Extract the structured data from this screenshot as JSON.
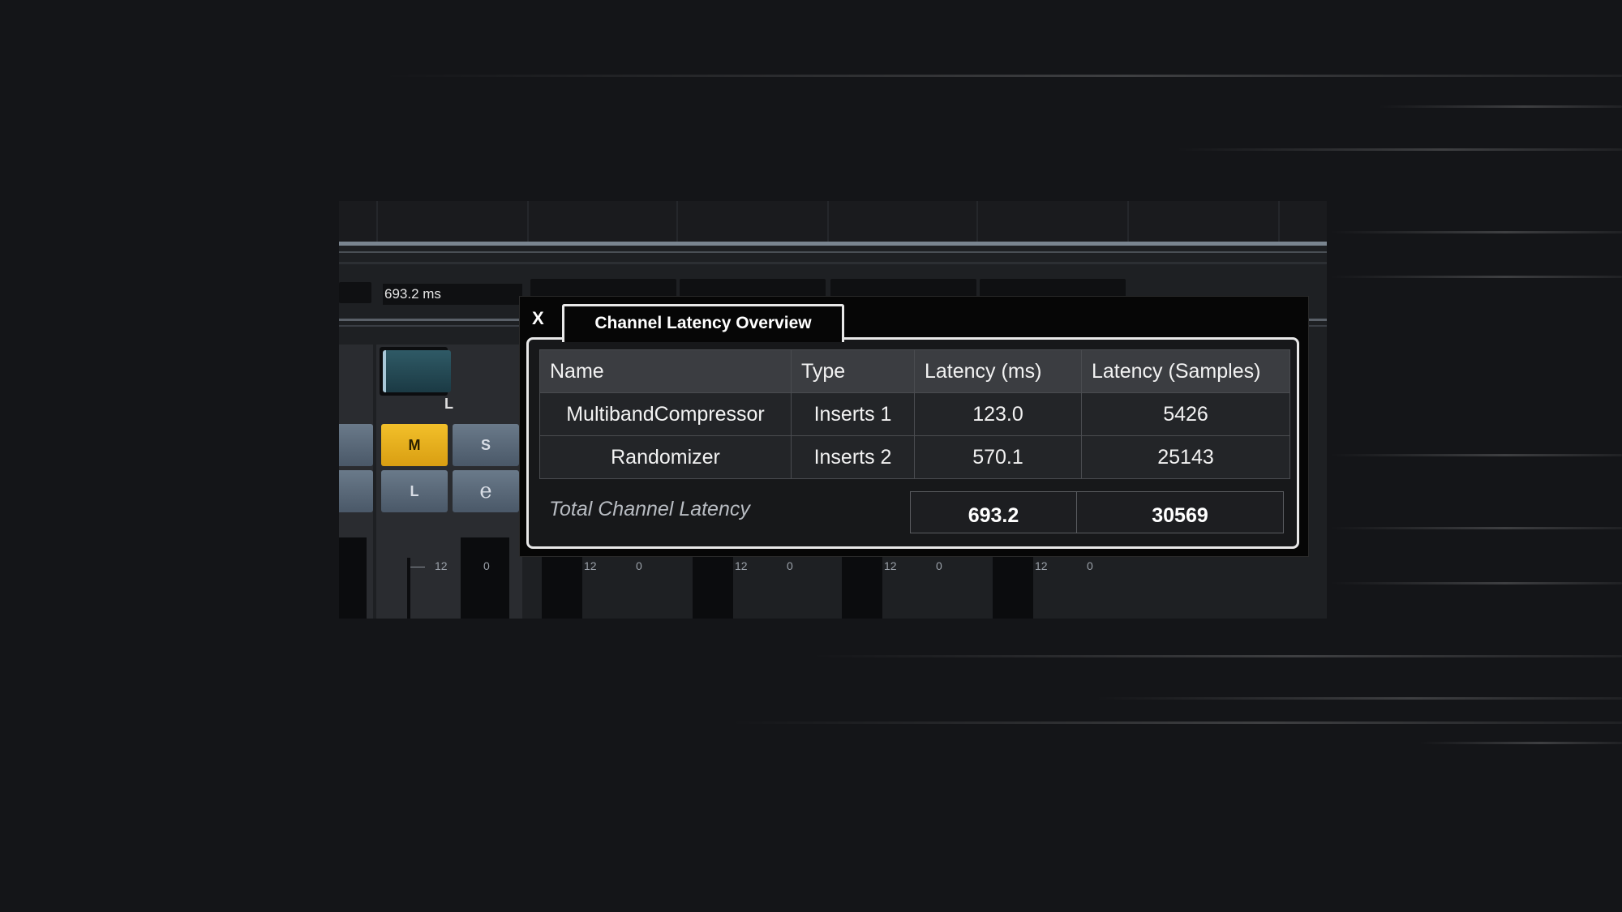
{
  "mixer": {
    "latency_readout": "693.2 ms",
    "pan_label": "L",
    "buttons": {
      "mute": "M",
      "solo": "S",
      "listen": "L",
      "edit": "e"
    },
    "scale_value_12": "12",
    "scale_value_0": "0"
  },
  "dialog": {
    "close_label": "X",
    "tab_title": "Channel Latency Overview",
    "columns": [
      "Name",
      "Type",
      "Latency (ms)",
      "Latency (Samples)"
    ],
    "rows": [
      {
        "name": "MultibandCompressor",
        "type": "Inserts 1",
        "latency_ms": "123.0",
        "latency_samples": "5426"
      },
      {
        "name": "Randomizer",
        "type": "Inserts 2",
        "latency_ms": "570.1",
        "latency_samples": "25143"
      }
    ],
    "total": {
      "label": "Total Channel Latency",
      "latency_ms": "693.2",
      "latency_samples": "30569"
    }
  },
  "colors": {
    "background": "#141518",
    "mute_active": "#f2c02a",
    "dialog_border": "#e8e8e8"
  }
}
